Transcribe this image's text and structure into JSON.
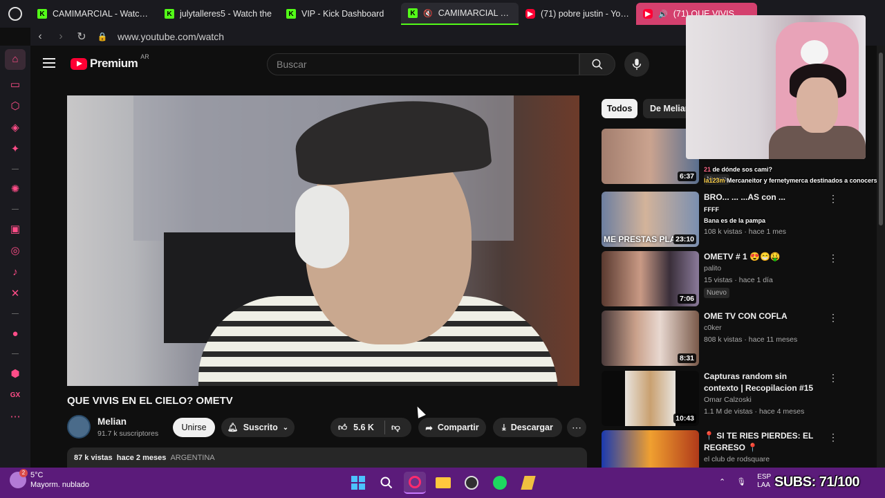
{
  "browser": {
    "tabs": [
      {
        "label": "CAMIMARCIAL - Watch th",
        "favicon": "kick",
        "state": "normal"
      },
      {
        "label": "julytalleres5 - Watch the",
        "favicon": "kick",
        "state": "normal"
      },
      {
        "label": "VIP - Kick Dashboard",
        "favicon": "kick",
        "state": "normal"
      },
      {
        "label": "CAMIMARCIAL Strea",
        "favicon": "kick",
        "state": "active"
      },
      {
        "label": "(71) pobre justin - YouTu",
        "favicon": "youtube",
        "state": "normal"
      },
      {
        "label": "(71) QUE VIVIS EN EL",
        "favicon": "youtube",
        "state": "highlight"
      }
    ],
    "url": "www.youtube.com/watch"
  },
  "youtube": {
    "brand": "Premium",
    "country": "AR",
    "search_placeholder": "Buscar",
    "video": {
      "title": "QUE VIVIS EN EL CIELO? OMETV",
      "channel": "Melian",
      "subscribers": "91.7 k suscriptores",
      "join_label": "Unirse",
      "subscribed_label": "Suscrito",
      "likes": "5.6 K",
      "share_label": "Compartir",
      "download_label": "Descargar",
      "views": "87 k vistas",
      "age": "hace 2 meses",
      "tag": "ARGENTINA"
    },
    "chips": [
      "Todos",
      "De Melian"
    ],
    "recommendations": [
      {
        "title": "",
        "channel": "",
        "meta": "",
        "badge": "Nuevo",
        "duration": "6:37"
      },
      {
        "title": "BRO... ... ...AS con ...",
        "channel": "",
        "meta": "108 k vistas · hace 1 mes",
        "badge": "",
        "duration": "23:10",
        "thumb_text": "ME PRESTAS PLATA"
      },
      {
        "title": "OMETV # 1 😍😁🤑",
        "channel": "palito",
        "meta": "15 vistas · hace 1 día",
        "badge": "Nuevo",
        "duration": "7:06"
      },
      {
        "title": "OME TV CON COFLA",
        "channel": "c0ker",
        "meta": "808 k vistas · hace 11 meses",
        "badge": "",
        "duration": "8:31"
      },
      {
        "title": "Capturas random sin contexto | Recopilacion #15",
        "channel": "Omar Calzoski",
        "meta": "1.1 M de vistas · hace 4 meses",
        "badge": "",
        "duration": "10:43"
      },
      {
        "title": "SI TE RIES PIERDES: EL REGRESO",
        "channel": "el club de rodsquare",
        "meta": "",
        "badge": "",
        "duration": ""
      }
    ]
  },
  "chat": [
    {
      "user": "21",
      "text": "de dónde sos cami?"
    },
    {
      "user": "la123m",
      "text": "Mercaneitor y fernetymerca destinados a conocerse"
    },
    {
      "user": "",
      "text": "FFFF"
    },
    {
      "user": "Bana",
      "text": "es de la pampa"
    }
  ],
  "taskbar": {
    "temperature": "5°C",
    "weather": "Mayorm. nublado",
    "weather_badge": "2",
    "lang": "ESP",
    "lang_sub": "LAA"
  },
  "overlay": {
    "subs": "SUBS: 71/100"
  },
  "colors": {
    "kick_green": "#53fc18",
    "youtube_red": "#ff0033",
    "taskbar": "#5b1b7a",
    "opera_pink": "#ff4d88"
  }
}
